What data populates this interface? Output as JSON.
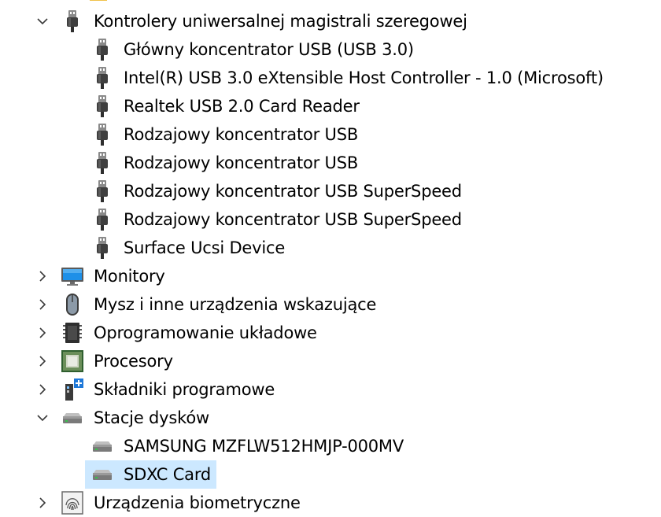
{
  "tree": {
    "top_partial": {
      "icon": "device-icon"
    },
    "usb_controllers": {
      "label": "Kontrolery uniwersalnej magistrali szeregowej",
      "expanded": true,
      "icon": "usb-connector-icon",
      "children": [
        {
          "label": "Główny koncentrator USB (USB 3.0)",
          "icon": "usb-connector-icon"
        },
        {
          "label": "Intel(R) USB 3.0 eXtensible Host Controller - 1.0 (Microsoft)",
          "icon": "usb-connector-icon"
        },
        {
          "label": "Realtek USB 2.0 Card Reader",
          "icon": "usb-connector-icon"
        },
        {
          "label": "Rodzajowy koncentrator USB",
          "icon": "usb-connector-icon"
        },
        {
          "label": "Rodzajowy koncentrator USB",
          "icon": "usb-connector-icon"
        },
        {
          "label": "Rodzajowy koncentrator USB SuperSpeed",
          "icon": "usb-connector-icon"
        },
        {
          "label": "Rodzajowy koncentrator USB SuperSpeed",
          "icon": "usb-connector-icon"
        },
        {
          "label": "Surface Ucsi Device",
          "icon": "usb-connector-icon"
        }
      ]
    },
    "monitors": {
      "label": "Monitory",
      "expanded": false,
      "icon": "monitor-icon"
    },
    "mice": {
      "label": "Mysz i inne urządzenia wskazujące",
      "expanded": false,
      "icon": "mouse-icon"
    },
    "firmware": {
      "label": "Oprogramowanie układowe",
      "expanded": false,
      "icon": "firmware-chip-icon"
    },
    "processors": {
      "label": "Procesory",
      "expanded": false,
      "icon": "processor-icon"
    },
    "software_components": {
      "label": "Składniki programowe",
      "expanded": false,
      "icon": "software-component-icon"
    },
    "disk_drives": {
      "label": "Stacje dysków",
      "expanded": true,
      "icon": "disk-drive-icon",
      "children": [
        {
          "label": "SAMSUNG MZFLW512HMJP-000MV",
          "icon": "disk-drive-icon",
          "selected": false
        },
        {
          "label": "SDXC Card",
          "icon": "disk-drive-icon",
          "selected": true
        }
      ]
    },
    "biometric": {
      "label": "Urządzenia biometryczne",
      "expanded": false,
      "icon": "fingerprint-icon"
    }
  },
  "colors": {
    "selection": "#cce8ff",
    "chevron": "#3a3a3a",
    "monitor_blue": "#1e90e8",
    "drive_led": "#36c24a"
  }
}
